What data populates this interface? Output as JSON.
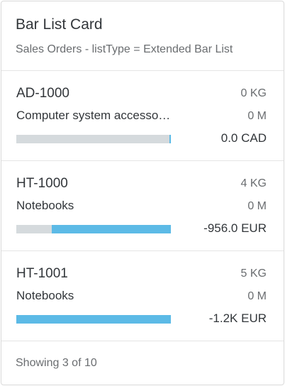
{
  "header": {
    "title": "Bar List Card",
    "subtitle": "Sales Orders - listType = Extended Bar List"
  },
  "items": [
    {
      "title": "AD-1000",
      "first_value": "0 KG",
      "description": "Computer system accessories",
      "second_value": "0 M",
      "third_value": "0.0 CAD",
      "bar_fraction": 0.01
    },
    {
      "title": "HT-1000",
      "first_value": "4 KG",
      "description": "Notebooks",
      "second_value": "0 M",
      "third_value": "-956.0 EUR",
      "bar_fraction": 0.77
    },
    {
      "title": "HT-1001",
      "first_value": "5 KG",
      "description": "Notebooks",
      "second_value": "0 M",
      "third_value": "-1.2K EUR",
      "bar_fraction": 1.0
    }
  ],
  "footer": {
    "text": "Showing 3 of 10"
  },
  "colors": {
    "bar_fill": "#5cbae6",
    "bar_track": "#d5dadd",
    "border": "#d9d9d9"
  }
}
